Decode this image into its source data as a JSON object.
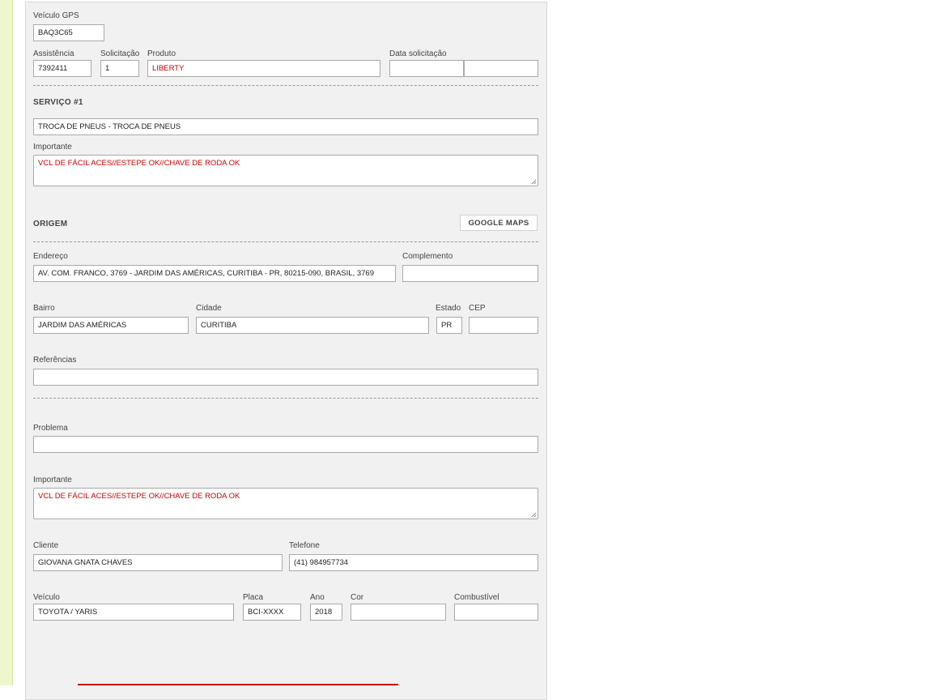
{
  "gps": {
    "label": "Veículo GPS",
    "value": "BAQ3C65"
  },
  "header_row": {
    "assistencia": {
      "label": "Assistência",
      "value": "7392411"
    },
    "solicitacao": {
      "label": "Solicitação",
      "value": "1"
    },
    "produto": {
      "label": "Produto",
      "value": "LIBERTY"
    },
    "data_solicitacao": {
      "label": "Data solicitação",
      "value_date": "",
      "value_time": ""
    }
  },
  "servico": {
    "title": "SERVIÇO #1",
    "service_value": "TROCA DE PNEUS - TROCA DE PNEUS",
    "importante_label": "Importante",
    "importante_value": "VCL DE FÁCIL ACES//ESTEPE OK//CHAVE DE RODA OK"
  },
  "origem": {
    "title": "ORIGEM",
    "maps_button": "GOOGLE MAPS",
    "endereco": {
      "label": "Endereço",
      "value": "AV. COM. FRANCO, 3769 - JARDIM DAS AMÉRICAS, CURITIBA - PR, 80215-090, BRASIL, 3769"
    },
    "complemento": {
      "label": "Complemento",
      "value": ""
    },
    "bairro": {
      "label": "Bairro",
      "value": "JARDIM DAS AMÉRICAS"
    },
    "cidade": {
      "label": "Cidade",
      "value": "CURITIBA"
    },
    "estado": {
      "label": "Estado",
      "value": "PR"
    },
    "cep": {
      "label": "CEP",
      "value": ""
    },
    "referencias": {
      "label": "Referências",
      "value": ""
    }
  },
  "problema": {
    "label": "Problema",
    "value": ""
  },
  "importante2": {
    "label": "Importante",
    "value": "VCL DE FÁCIL ACES//ESTEPE OK//CHAVE DE RODA OK"
  },
  "cliente": {
    "label": "Cliente",
    "value": "GIOVANA GNATA CHAVES"
  },
  "telefone": {
    "label": "Telefone",
    "value": "(41) 984957734"
  },
  "veiculo": {
    "label": "Veículo",
    "value": "TOYOTA / YARIS"
  },
  "placa": {
    "label": "Placa",
    "value": "BCI-XXXX"
  },
  "ano": {
    "label": "Ano",
    "value": "2018"
  },
  "cor": {
    "label": "Cor",
    "value": ""
  },
  "combustivel": {
    "label": "Combustível",
    "value": ""
  },
  "colors": {
    "accent_red": "#cc0000",
    "side_strip": "#eef7cc",
    "panel_bg": "#f1f1f1"
  }
}
